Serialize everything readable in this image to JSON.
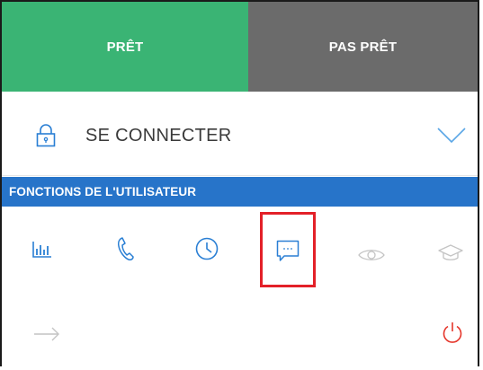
{
  "status": {
    "ready_label": "PRÊT",
    "not_ready_label": "PAS PRÊT",
    "ready_color": "#3ab474",
    "not_ready_color": "#6b6b6b"
  },
  "login": {
    "icon": "lock-icon",
    "label": "SE CONNECTER",
    "expand_icon": "chevron-down-icon"
  },
  "section": {
    "title": "FONCTIONS DE L'UTILISATEUR",
    "color": "#2774c9"
  },
  "functions": [
    {
      "icon": "bar-chart-icon",
      "state": "active"
    },
    {
      "icon": "phone-icon",
      "state": "active"
    },
    {
      "icon": "clock-icon",
      "state": "active"
    },
    {
      "icon": "chat-icon",
      "state": "active",
      "highlighted": true
    },
    {
      "icon": "eye-icon",
      "state": "disabled"
    },
    {
      "icon": "graduation-cap-icon",
      "state": "disabled"
    }
  ],
  "bottom": {
    "left_icon": "arrow-right-icon",
    "right_icon": "power-icon",
    "power_color": "#e5362b"
  },
  "colors": {
    "accent_blue": "#2a7fd4",
    "disabled_gray": "#c4c4c4",
    "highlight_red": "#e32028"
  }
}
